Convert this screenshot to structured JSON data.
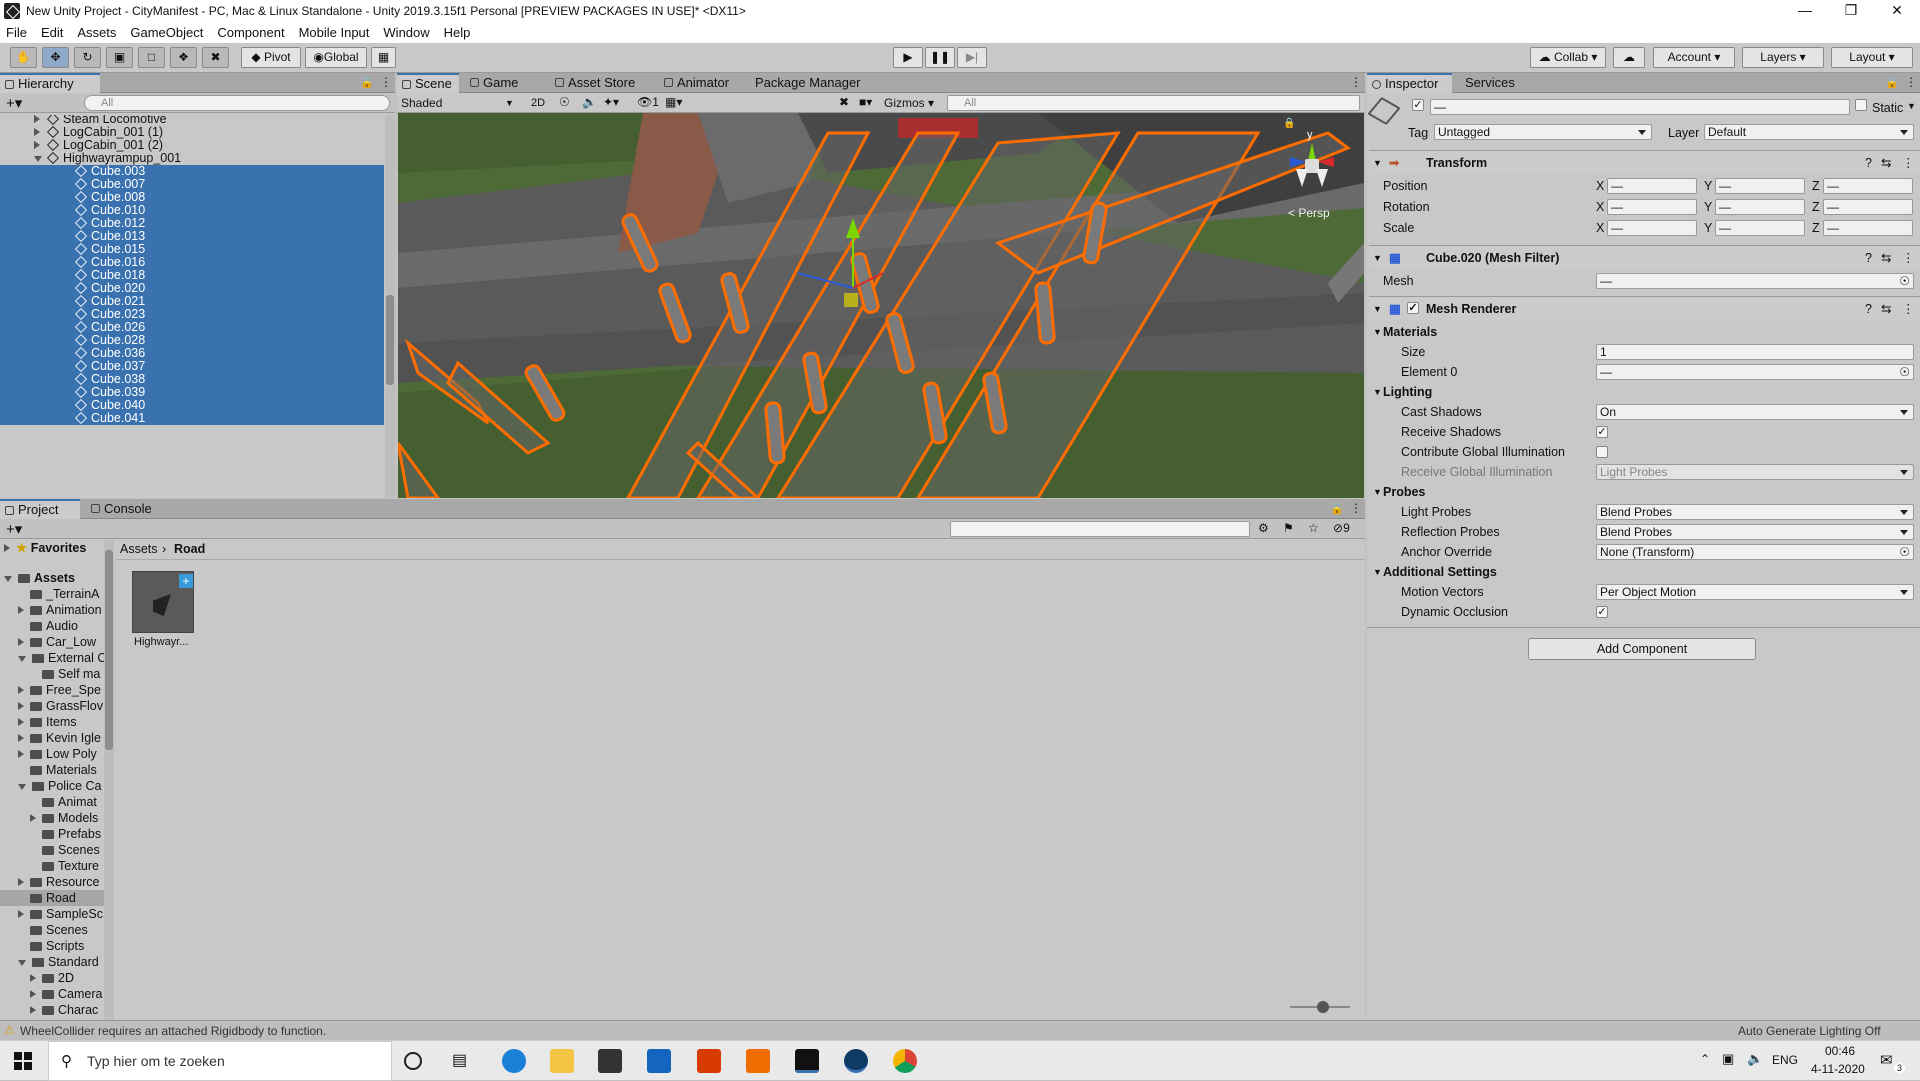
{
  "window": {
    "title": "New Unity Project - CityManifest - PC, Mac & Linux Standalone - Unity 2019.3.15f1 Personal [PREVIEW PACKAGES IN USE]* <DX11>"
  },
  "menu": [
    "File",
    "Edit",
    "Assets",
    "GameObject",
    "Component",
    "Mobile Input",
    "Window",
    "Help"
  ],
  "toolbar": {
    "pivot": "Pivot",
    "global": "Global",
    "collab": "Collab",
    "account": "Account",
    "layers": "Layers",
    "layout": "Layout"
  },
  "hierarchy": {
    "tab": "Hierarchy",
    "search_placeholder": "All",
    "items": [
      {
        "label": "Steam Locomotive",
        "indent": 1,
        "selected": false,
        "arrow": "right"
      },
      {
        "label": "LogCabin_001 (1)",
        "indent": 1,
        "selected": false,
        "arrow": "right"
      },
      {
        "label": "LogCabin_001 (2)",
        "indent": 1,
        "selected": false,
        "arrow": "right"
      },
      {
        "label": "Highwayrampup_001",
        "indent": 1,
        "selected": false,
        "arrow": "down"
      },
      {
        "label": "Cube.003",
        "indent": 2,
        "selected": true
      },
      {
        "label": "Cube.007",
        "indent": 2,
        "selected": true
      },
      {
        "label": "Cube.008",
        "indent": 2,
        "selected": true
      },
      {
        "label": "Cube.010",
        "indent": 2,
        "selected": true
      },
      {
        "label": "Cube.012",
        "indent": 2,
        "selected": true
      },
      {
        "label": "Cube.013",
        "indent": 2,
        "selected": true
      },
      {
        "label": "Cube.015",
        "indent": 2,
        "selected": true
      },
      {
        "label": "Cube.016",
        "indent": 2,
        "selected": true
      },
      {
        "label": "Cube.018",
        "indent": 2,
        "selected": true
      },
      {
        "label": "Cube.020",
        "indent": 2,
        "selected": true
      },
      {
        "label": "Cube.021",
        "indent": 2,
        "selected": true
      },
      {
        "label": "Cube.023",
        "indent": 2,
        "selected": true
      },
      {
        "label": "Cube.026",
        "indent": 2,
        "selected": true
      },
      {
        "label": "Cube.028",
        "indent": 2,
        "selected": true
      },
      {
        "label": "Cube.036",
        "indent": 2,
        "selected": true
      },
      {
        "label": "Cube.037",
        "indent": 2,
        "selected": true
      },
      {
        "label": "Cube.038",
        "indent": 2,
        "selected": true
      },
      {
        "label": "Cube.039",
        "indent": 2,
        "selected": true
      },
      {
        "label": "Cube.040",
        "indent": 2,
        "selected": true
      },
      {
        "label": "Cube.041",
        "indent": 2,
        "selected": true
      }
    ]
  },
  "scene": {
    "tabs": [
      "Scene",
      "Game",
      "Asset Store",
      "Animator",
      "Package Manager"
    ],
    "shading": "Shaded",
    "mode2d": "2D",
    "hidden_count": "1",
    "gizmos": "Gizmos",
    "search_placeholder": "All",
    "persp": "< Persp",
    "axis_y": "y"
  },
  "inspector": {
    "tabs": [
      "Inspector",
      "Services"
    ],
    "object_name": "—",
    "static": "Static",
    "tag_label": "Tag",
    "tag_value": "Untagged",
    "layer_label": "Layer",
    "layer_value": "Default",
    "transform": {
      "title": "Transform",
      "rows": [
        "Position",
        "Rotation",
        "Scale"
      ],
      "axes": [
        "X",
        "Y",
        "Z"
      ],
      "mixed": "—"
    },
    "meshfilter": {
      "title": "Cube.020 (Mesh Filter)",
      "mesh_label": "Mesh",
      "mesh_value": "—"
    },
    "meshrenderer": {
      "title": "Mesh Renderer",
      "materials": "Materials",
      "size_label": "Size",
      "size_value": "1",
      "element0_label": "Element 0",
      "element0_value": "—",
      "lighting": "Lighting",
      "cast_shadows_label": "Cast Shadows",
      "cast_shadows_value": "On",
      "receive_shadows_label": "Receive Shadows",
      "contribute_gi_label": "Contribute Global Illumination",
      "receive_gi_label": "Receive Global Illumination",
      "receive_gi_value": "Light Probes",
      "probes": "Probes",
      "light_probes_label": "Light Probes",
      "light_probes_value": "Blend Probes",
      "reflection_probes_label": "Reflection Probes",
      "reflection_probes_value": "Blend Probes",
      "anchor_override_label": "Anchor Override",
      "anchor_override_value": "None (Transform)",
      "additional": "Additional Settings",
      "motion_vectors_label": "Motion Vectors",
      "motion_vectors_value": "Per Object Motion",
      "dynamic_occlusion_label": "Dynamic Occlusion"
    },
    "add_component": "Add Component"
  },
  "project": {
    "tabs": [
      "Project",
      "Console"
    ],
    "favorites": "Favorites",
    "assets": "Assets",
    "hidden_count": "9",
    "breadcrumb_root": "Assets",
    "breadcrumb_current": "Road",
    "asset_label": "Highwayr...",
    "tree": [
      {
        "label": "_TerrainA",
        "indent": 2,
        "arrow": "none"
      },
      {
        "label": "Animation",
        "indent": 1,
        "arrow": "right"
      },
      {
        "label": "Audio",
        "indent": 2,
        "arrow": "none"
      },
      {
        "label": "Car_Low",
        "indent": 1,
        "arrow": "right"
      },
      {
        "label": "External C",
        "indent": 1,
        "arrow": "down"
      },
      {
        "label": "Self ma",
        "indent": 3,
        "arrow": "none"
      },
      {
        "label": "Free_Spe",
        "indent": 1,
        "arrow": "right"
      },
      {
        "label": "GrassFlov",
        "indent": 1,
        "arrow": "right"
      },
      {
        "label": "Items",
        "indent": 1,
        "arrow": "right"
      },
      {
        "label": "Kevin Igle",
        "indent": 1,
        "arrow": "right"
      },
      {
        "label": "Low Poly",
        "indent": 1,
        "arrow": "right"
      },
      {
        "label": "Materials",
        "indent": 2,
        "arrow": "none"
      },
      {
        "label": "Police Ca",
        "indent": 1,
        "arrow": "down"
      },
      {
        "label": "Animat",
        "indent": 3,
        "arrow": "none"
      },
      {
        "label": "Models",
        "indent": 2,
        "arrow": "right"
      },
      {
        "label": "Prefabs",
        "indent": 3,
        "arrow": "none"
      },
      {
        "label": "Scenes",
        "indent": 3,
        "arrow": "none"
      },
      {
        "label": "Texture",
        "indent": 3,
        "arrow": "none"
      },
      {
        "label": "Resource",
        "indent": 1,
        "arrow": "right"
      },
      {
        "label": "Road",
        "indent": 2,
        "arrow": "none",
        "selected": true
      },
      {
        "label": "SampleSc",
        "indent": 1,
        "arrow": "right"
      },
      {
        "label": "Scenes",
        "indent": 2,
        "arrow": "none"
      },
      {
        "label": "Scripts",
        "indent": 2,
        "arrow": "none"
      },
      {
        "label": "Standard",
        "indent": 1,
        "arrow": "down"
      },
      {
        "label": "2D",
        "indent": 2,
        "arrow": "right"
      },
      {
        "label": "Camera",
        "indent": 2,
        "arrow": "right"
      },
      {
        "label": "Charac",
        "indent": 2,
        "arrow": "right"
      }
    ]
  },
  "statusbar": {
    "warning": "WheelCollider requires an attached Rigidbody to function.",
    "lighting": "Auto Generate Lighting Off"
  },
  "taskbar": {
    "search_placeholder": "Typ hier om te zoeken",
    "lang": "ENG",
    "time": "00:46",
    "date": "4-11-2020",
    "notif_count": "3"
  }
}
